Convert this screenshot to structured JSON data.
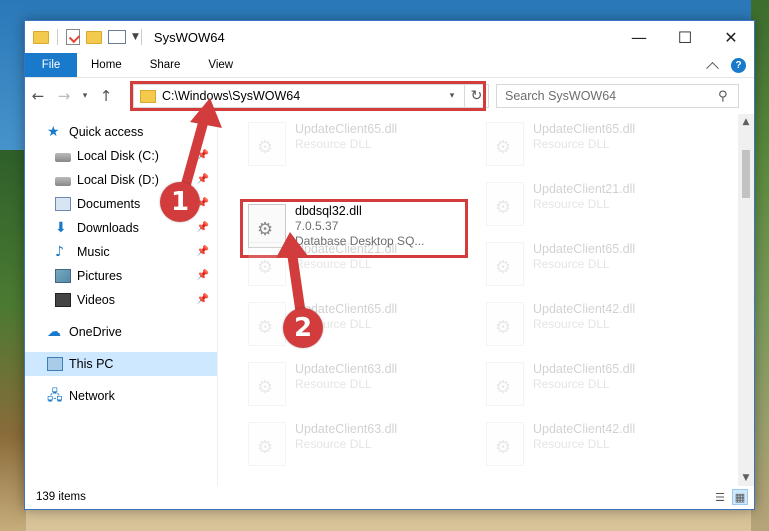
{
  "window": {
    "title": "SysWOW64",
    "controls": {
      "minimize": "—",
      "maximize": "☐",
      "close": "✕"
    }
  },
  "ribbon": {
    "tabs": [
      "File",
      "Home",
      "Share",
      "View"
    ],
    "help": "?"
  },
  "address": {
    "path": "C:\\Windows\\SysWOW64",
    "search_placeholder": "Search SysWOW64"
  },
  "navpane": {
    "quick_access": "Quick access",
    "items": [
      {
        "label": "Local Disk (C:)",
        "icon": "disk-icon",
        "pinned": true
      },
      {
        "label": "Local Disk (D:)",
        "icon": "disk-icon",
        "pinned": true
      },
      {
        "label": "Documents",
        "icon": "documents-icon",
        "pinned": true
      },
      {
        "label": "Downloads",
        "icon": "downloads-icon",
        "pinned": true
      },
      {
        "label": "Music",
        "icon": "music-icon",
        "pinned": true
      },
      {
        "label": "Pictures",
        "icon": "pictures-icon",
        "pinned": true
      },
      {
        "label": "Videos",
        "icon": "videos-icon",
        "pinned": true
      }
    ],
    "onedrive": "OneDrive",
    "this_pc": "This PC",
    "network": "Network"
  },
  "files": {
    "col1": [
      {
        "name": "UpdateClient65.dll",
        "sub": "Resource DLL",
        "faded": true
      },
      {
        "name": "dbdsql32.dll",
        "sub": "7.0.5.37",
        "sub2": "Database Desktop SQ...",
        "faded": false
      },
      {
        "name": "UpdateClient21.dll",
        "sub": "Resource DLL",
        "faded": true
      },
      {
        "name": "UpdateClient65.dll",
        "sub": "Resource DLL",
        "faded": true
      },
      {
        "name": "UpdateClient63.dll",
        "sub": "Resource DLL",
        "faded": true
      },
      {
        "name": "UpdateClient63.dll",
        "sub": "Resource DLL",
        "faded": true
      }
    ],
    "col2": [
      {
        "name": "UpdateClient65.dll",
        "sub": "Resource DLL",
        "faded": true
      },
      {
        "name": "UpdateClient21.dll",
        "sub": "Resource DLL",
        "faded": true
      },
      {
        "name": "UpdateClient65.dll",
        "sub": "Resource DLL",
        "faded": true
      },
      {
        "name": "UpdateClient42.dll",
        "sub": "Resource DLL",
        "faded": true
      },
      {
        "name": "UpdateClient65.dll",
        "sub": "Resource DLL",
        "faded": true
      },
      {
        "name": "UpdateClient42.dll",
        "sub": "Resource DLL",
        "faded": true
      }
    ]
  },
  "status": {
    "item_count": "139 items"
  },
  "annotations": {
    "step1": "1",
    "step2": "2",
    "color": "#d33c3c"
  }
}
